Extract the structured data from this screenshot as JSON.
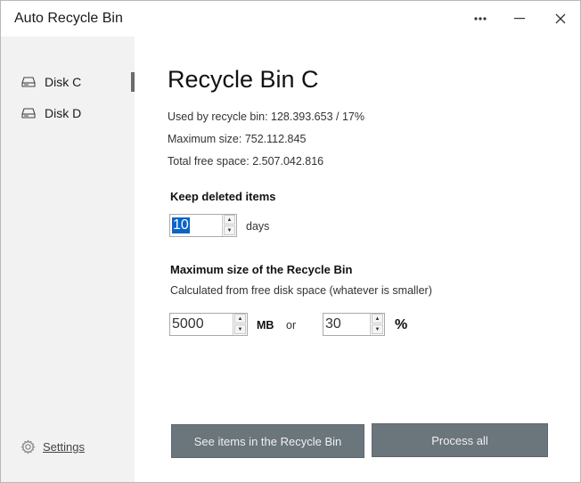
{
  "window": {
    "title": "Auto Recycle Bin",
    "controls": {
      "more": "more-options",
      "minimize": "minimize",
      "close": "close"
    }
  },
  "sidebar": {
    "items": [
      {
        "label": "Disk C",
        "icon": "drive-icon",
        "selected": true
      },
      {
        "label": "Disk D",
        "icon": "drive-icon",
        "selected": false
      }
    ],
    "settings_label": "Settings",
    "settings_icon": "gear-icon"
  },
  "main": {
    "title": "Recycle Bin C",
    "used": "Used by recycle bin: 128.393.653 / 17%",
    "max_size": "Maximum size: 752.112.845",
    "free_space": "Total free space: 2.507.042.816",
    "keep": {
      "heading": "Keep deleted items",
      "value": "10",
      "unit": "days"
    },
    "max": {
      "heading": "Maximum size of the Recycle Bin",
      "subtext": "Calculated from free disk space (whatever is smaller)",
      "mb_value": "5000",
      "mb_unit": "MB",
      "or_label": "or",
      "pct_value": "30",
      "pct_unit": "%"
    }
  },
  "buttons": {
    "see_items": "See items in the Recycle Bin",
    "process_all": "Process all"
  },
  "colors": {
    "sidebar_bg": "#f2f2f2",
    "button_bg": "#6b757c",
    "selection": "#0a64c8"
  }
}
